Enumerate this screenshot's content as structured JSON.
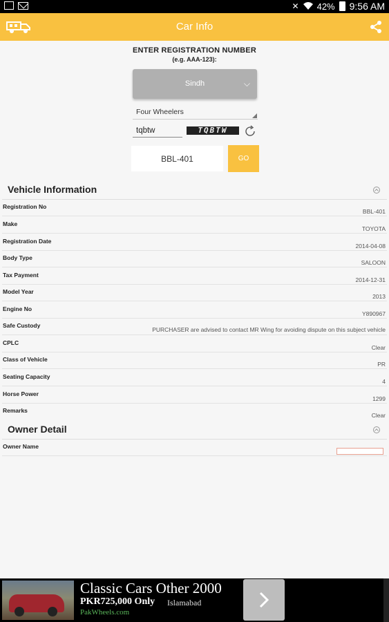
{
  "status_bar": {
    "battery": "42%",
    "time": "9:56 AM"
  },
  "action_bar": {
    "title": "Car Info",
    "logo_icon": "truck-logo-icon",
    "share_icon": "share-icon"
  },
  "form": {
    "title": "ENTER REGISTRATION NUMBER",
    "hint": "(e.g. AAA-123):",
    "province": "Sindh",
    "vehicle_type": "Four Wheelers",
    "captcha_value": "tqbtw",
    "captcha_text": "TQBTW",
    "registration_value": "BBL-401",
    "go_label": "GO"
  },
  "vehicle": {
    "title": "Vehicle Information",
    "rows": [
      {
        "label": "Registration No",
        "value": "BBL-401"
      },
      {
        "label": "Make",
        "value": "TOYOTA"
      },
      {
        "label": "Registration Date",
        "value": "2014-04-08"
      },
      {
        "label": "Body Type",
        "value": "SALOON"
      },
      {
        "label": "Tax Payment",
        "value": "2014-12-31"
      },
      {
        "label": "Model Year",
        "value": "2013"
      },
      {
        "label": "Engine No",
        "value": "Y890967"
      },
      {
        "label": "Safe Custody",
        "value": "PURCHASER are advised to contact MR Wing for avoiding dispute on this subject vehicle"
      },
      {
        "label": "CPLC",
        "value": "Clear"
      },
      {
        "label": "Class of Vehicle",
        "value": "PR"
      },
      {
        "label": "Seating Capacity",
        "value": "4"
      },
      {
        "label": "Horse Power",
        "value": "1299"
      },
      {
        "label": "Remarks",
        "value": "Clear"
      }
    ]
  },
  "owner": {
    "title": "Owner Detail",
    "rows": [
      {
        "label": "Owner Name",
        "value": ""
      }
    ]
  },
  "ad": {
    "title": "Classic Cars Other 2000",
    "price": "PKR725,000 Only",
    "city": "Islamabad",
    "site": "PakWheels.com"
  }
}
